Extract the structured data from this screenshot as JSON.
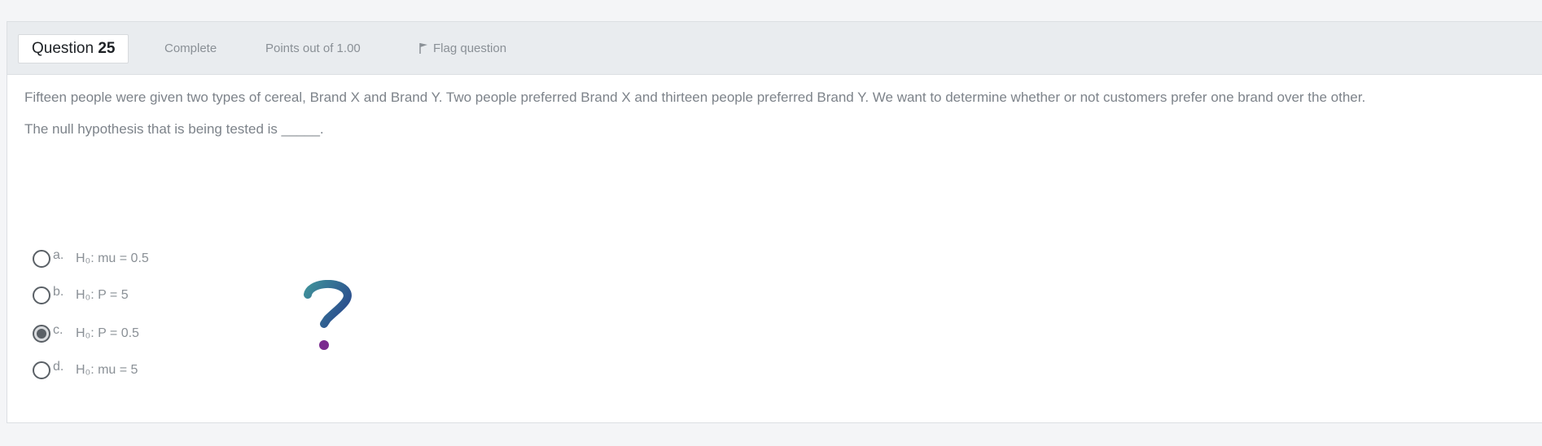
{
  "question": {
    "label": "Question",
    "number": "25",
    "state": "Complete",
    "grade": "Points out of 1.00",
    "flag_label": "Flag question"
  },
  "content": {
    "paragraph1": "Fifteen people were given two types of cereal, Brand X and Brand Y. Two people preferred Brand X and thirteen people preferred Brand Y. We want to determine whether or not customers prefer one brand over the other.",
    "paragraph2": "The null hypothesis that is being tested is _____."
  },
  "answers": [
    {
      "letter": "a.",
      "text": "H₀: mu = 0.5",
      "selected": false
    },
    {
      "letter": "b.",
      "text": "H₀: P = 5",
      "selected": false
    },
    {
      "letter": "c.",
      "text": "H₀: P = 0.5",
      "selected": true
    },
    {
      "letter": "d.",
      "text": "H₀: mu = 5",
      "selected": false
    }
  ],
  "icons": {
    "flag": "flag-icon",
    "question_mark": "question-mark-icon"
  },
  "colors": {
    "header_bg": "#e9ecef",
    "radio_border": "#5a6066",
    "qmark_teal": "#3f8f9a",
    "qmark_blue": "#2b4f8e",
    "qmark_dot": "#7a2a8e"
  }
}
